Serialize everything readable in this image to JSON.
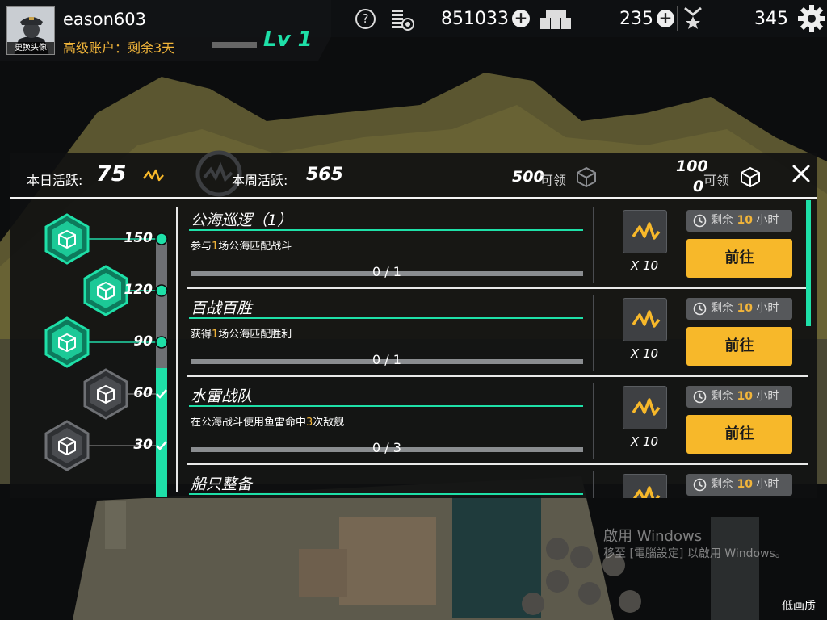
{
  "player": {
    "avatar_label": "更换头像",
    "username": "eason603",
    "account_status": "高级账户：剩余3天",
    "level": "Lv 1"
  },
  "resources": {
    "help": "?",
    "currency1": "851033",
    "currency2": "235",
    "currency3": "345"
  },
  "header": {
    "daily_label": "本日活跃:",
    "daily_value": "75",
    "weekly_label": "本周活跃:",
    "weekly_value": "565",
    "reward1_num": "500",
    "reward1_label": "可领",
    "reward2_num_top": "100",
    "reward2_num_bottom": "0",
    "reward2_label": "可领"
  },
  "milestones": [
    {
      "value": "150",
      "state": "available"
    },
    {
      "value": "120",
      "state": "available"
    },
    {
      "value": "90",
      "state": "available"
    },
    {
      "value": "60",
      "state": "claimed"
    },
    {
      "value": "30",
      "state": "claimed"
    }
  ],
  "progress_fill_fraction": 0.5,
  "quests": [
    {
      "title": "公海巡逻（1）",
      "desc_pre": "参与",
      "desc_hl": "1",
      "desc_post": "场公海匹配战斗",
      "progress": "0 / 1",
      "reward": "X 10",
      "timer_pre": "剩余 ",
      "timer_num": "10",
      "timer_post": " 小时",
      "button": "前往"
    },
    {
      "title": "百战百胜",
      "desc_pre": "获得",
      "desc_hl": "1",
      "desc_post": "场公海匹配胜利",
      "progress": "0 / 1",
      "reward": "X 10",
      "timer_pre": "剩余 ",
      "timer_num": "10",
      "timer_post": " 小时",
      "button": "前往"
    },
    {
      "title": "水雷战队",
      "desc_pre": "在公海战斗使用鱼雷命中",
      "desc_hl": "3",
      "desc_post": "次敌舰",
      "progress": "0 / 3",
      "reward": "X 10",
      "timer_pre": "剩余 ",
      "timer_num": "10",
      "timer_post": " 小时",
      "button": "前往"
    },
    {
      "title": "船只整备",
      "timer_pre": "剩余 ",
      "timer_num": "10",
      "timer_post": " 小时"
    }
  ],
  "watermark": {
    "line1": "啟用 Windows",
    "line2": "移至 [電腦設定] 以啟用 Windows。"
  },
  "quality_label": "低画质",
  "colors": {
    "accent_teal": "#1ee0a8",
    "gold": "#f2b53a",
    "button_yellow": "#f7b82a"
  }
}
